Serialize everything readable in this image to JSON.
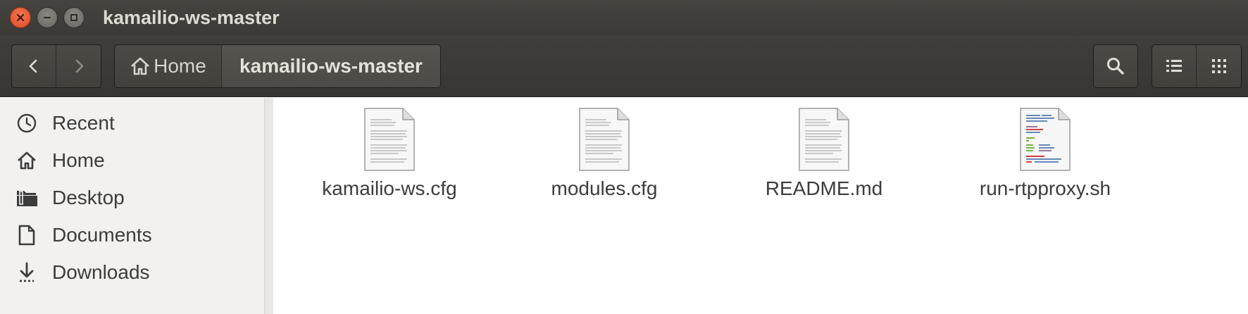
{
  "window": {
    "title": "kamailio-ws-master"
  },
  "toolbar": {
    "back_icon": "chevron-left-icon",
    "forward_icon": "chevron-right-icon",
    "breadcrumb": {
      "home_label": "Home",
      "current_label": "kamailio-ws-master"
    },
    "search_icon": "search-icon",
    "list_view_icon": "list-view-icon",
    "grid_view_icon": "grid-view-icon"
  },
  "sidebar": {
    "items": [
      {
        "label": "Recent",
        "icon": "clock-icon"
      },
      {
        "label": "Home",
        "icon": "home-icon"
      },
      {
        "label": "Desktop",
        "icon": "folder-icon"
      },
      {
        "label": "Documents",
        "icon": "document-icon"
      },
      {
        "label": "Downloads",
        "icon": "download-icon"
      }
    ]
  },
  "files": [
    {
      "name": "kamailio-ws.cfg",
      "icon": "text-file-icon"
    },
    {
      "name": "modules.cfg",
      "icon": "text-file-icon"
    },
    {
      "name": "README.md",
      "icon": "text-file-icon"
    },
    {
      "name": "run-rtpproxy.sh",
      "icon": "script-file-icon"
    }
  ],
  "colors": {
    "titlebar": "#3b3a36",
    "close_button": "#dd4b21",
    "sidebar_bg": "#f2f1f0",
    "content_bg": "#ffffff",
    "text": "#3c3c3c"
  }
}
